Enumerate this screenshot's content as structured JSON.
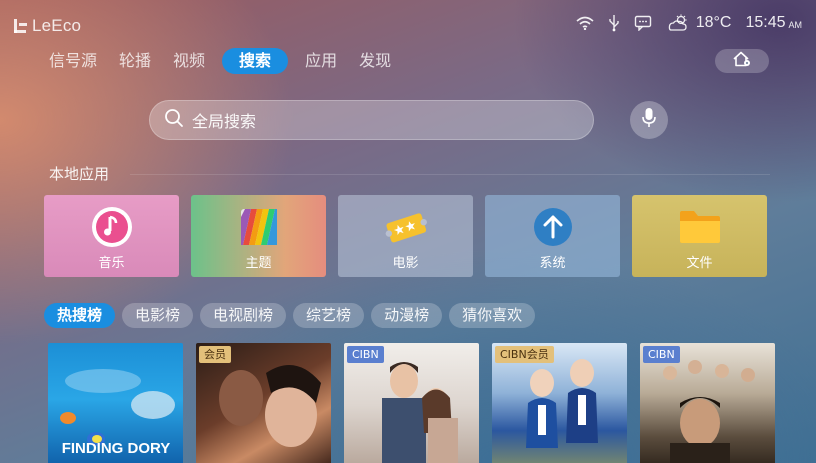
{
  "brand": {
    "logo_text": "LeEco"
  },
  "status": {
    "weather_icon": "partly-cloudy-icon",
    "temperature": "18°C",
    "time": "15:45",
    "ampm": "AM"
  },
  "nav": {
    "items": [
      {
        "label": "信号源"
      },
      {
        "label": "轮播"
      },
      {
        "label": "视频"
      },
      {
        "label": "搜索",
        "active": true
      },
      {
        "label": "应用"
      },
      {
        "label": "发现"
      }
    ]
  },
  "search": {
    "placeholder": "全局搜索"
  },
  "local_apps": {
    "title": "本地应用",
    "items": [
      {
        "label": "音乐",
        "icon": "music-icon"
      },
      {
        "label": "主题",
        "icon": "theme-icon"
      },
      {
        "label": "电影",
        "icon": "movie-ticket-icon"
      },
      {
        "label": "系统",
        "icon": "system-update-icon"
      },
      {
        "label": "文件",
        "icon": "folder-icon"
      }
    ]
  },
  "tags": {
    "items": [
      {
        "label": "热搜榜",
        "active": true
      },
      {
        "label": "电影榜"
      },
      {
        "label": "电视剧榜"
      },
      {
        "label": "综艺榜"
      },
      {
        "label": "动漫榜"
      },
      {
        "label": "猜你喜欢"
      }
    ]
  },
  "posters": {
    "items": [
      {
        "badge": "",
        "title_text": "FINDING DORY"
      },
      {
        "badge": "会员"
      },
      {
        "badge": "CIBN"
      },
      {
        "badge": "CIBN会员"
      },
      {
        "badge": "CIBN"
      }
    ]
  },
  "colors": {
    "accent": "#1a8ee0"
  }
}
